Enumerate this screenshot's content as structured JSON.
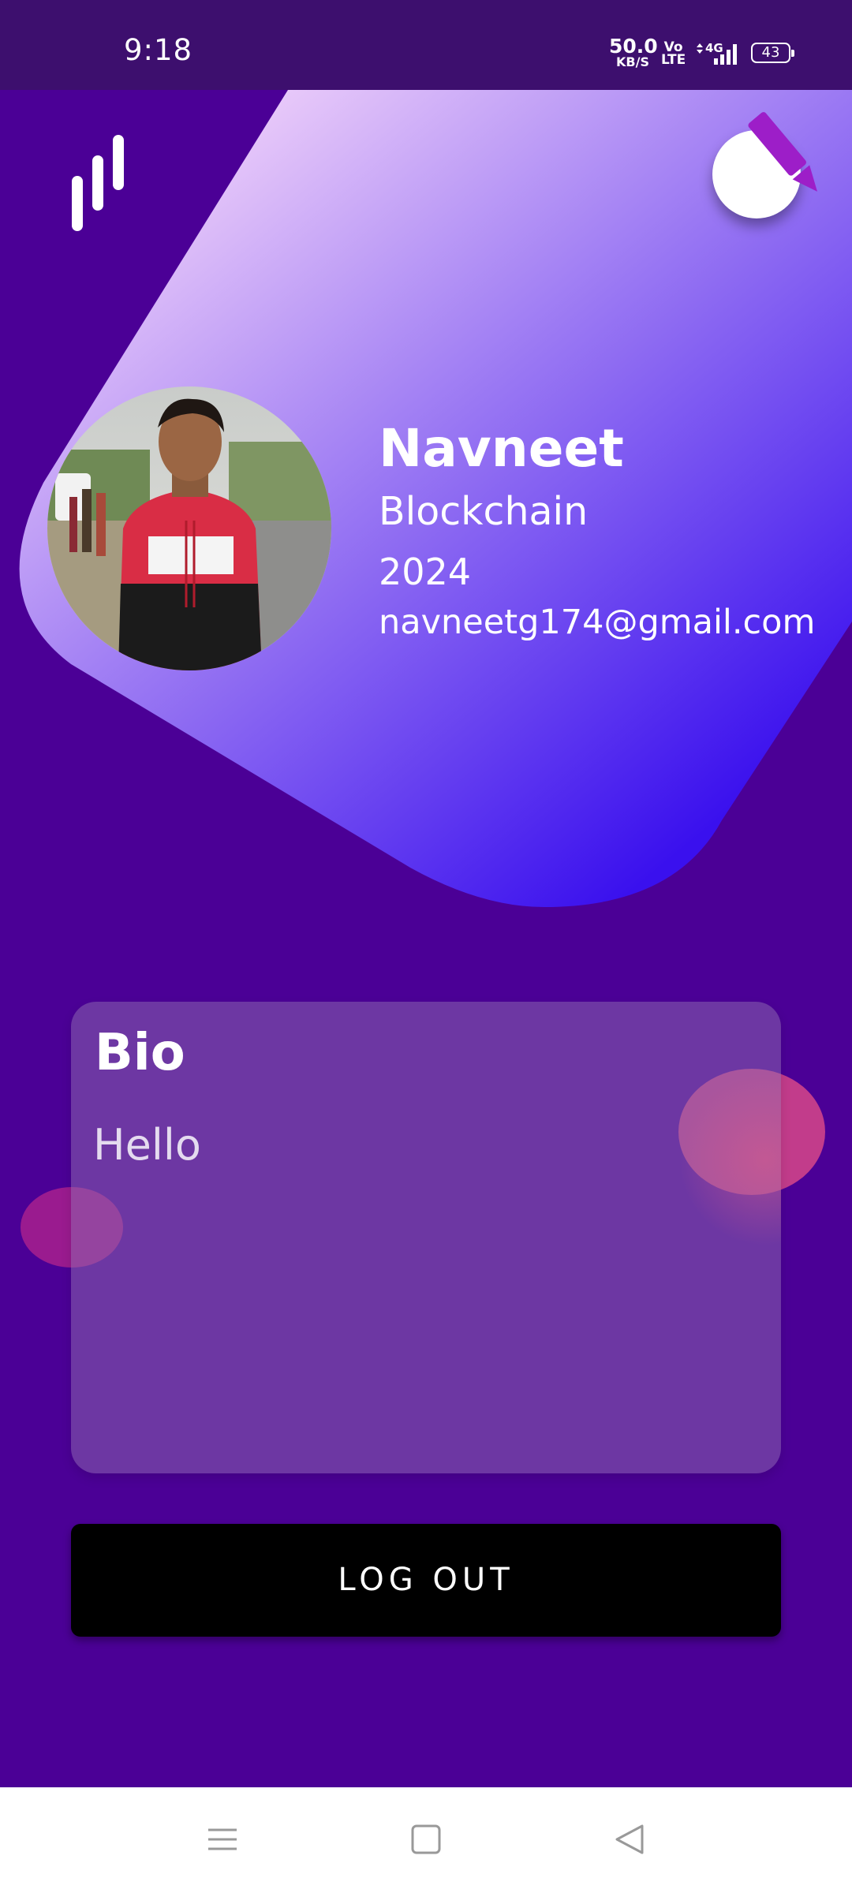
{
  "status_bar": {
    "time": "9:18",
    "net_speed_value": "50.0",
    "net_speed_unit": "KB/S",
    "volte_top": "Vo",
    "volte_bottom": "LTE",
    "network": "4G",
    "battery": "43"
  },
  "header": {
    "menu_icon": "bars-icon",
    "edit_icon": "pencil-icon"
  },
  "profile": {
    "name": "Navneet",
    "branch": "Blockchain",
    "year": "2024",
    "email": "navneetg174@gmail.com"
  },
  "bio": {
    "title": "Bio",
    "text": "Hello"
  },
  "logout": {
    "label": "LOG OUT"
  },
  "nav": {
    "recents_icon": "menu-lines-icon",
    "home_icon": "square-icon",
    "back_icon": "triangle-back-icon"
  },
  "colors": {
    "background": "#4b0096",
    "status_bar": "#3d0f6e",
    "hero_gradient_start": "#eecffa",
    "hero_gradient_mid": "#9a78f3",
    "hero_gradient_end": "#3a10ee",
    "pencil": "#9d1ec8",
    "logout_bg": "#000000"
  }
}
